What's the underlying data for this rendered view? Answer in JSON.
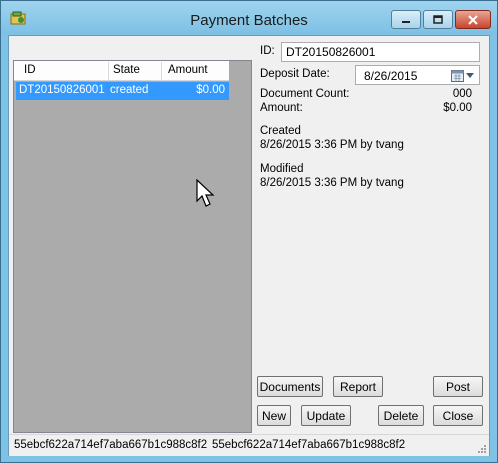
{
  "window": {
    "title": "Payment Batches",
    "icons": {
      "app": "app-icon",
      "minimize": "minimize-icon",
      "maximize": "maximize-icon",
      "close": "close-icon"
    }
  },
  "grid": {
    "columns": [
      "ID",
      "State",
      "Amount"
    ],
    "rows": [
      {
        "id": "DT20150826001",
        "state": "created",
        "amount": "$0.00",
        "selected": true
      }
    ]
  },
  "details": {
    "id_label": "ID:",
    "id_value": "DT20150826001",
    "deposit_date_label": "Deposit Date:",
    "deposit_date_value": "8/26/2015",
    "document_count_label": "Document Count:",
    "document_count_value": "000",
    "amount_label": "Amount:",
    "amount_value": "$0.00",
    "created_label": "Created",
    "created_value": "8/26/2015 3:36 PM by tvang",
    "modified_label": "Modified",
    "modified_value": "8/26/2015 3:36 PM by tvang"
  },
  "buttons": {
    "documents": "Documents",
    "report": "Report",
    "post": "Post",
    "new": "New",
    "update": "Update",
    "delete": "Delete",
    "close": "Close"
  },
  "status": {
    "left": "55ebcf622a714ef7aba667b1c988c8f2",
    "right": "55ebcf622a714ef7aba667b1c988c8f2"
  },
  "colors": {
    "selection": "#3399ff",
    "grid_background": "#ababab",
    "title_bar": "#7ec3e6"
  }
}
